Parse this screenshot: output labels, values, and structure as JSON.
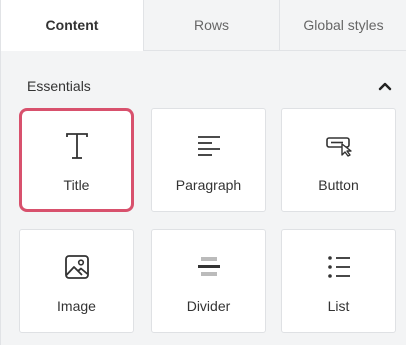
{
  "tabs": [
    {
      "label": "Content",
      "active": true
    },
    {
      "label": "Rows",
      "active": false
    },
    {
      "label": "Global styles",
      "active": false
    }
  ],
  "section": {
    "title": "Essentials",
    "collapse_icon": "chevron-up-icon"
  },
  "blocks": [
    {
      "label": "Title",
      "icon": "title-icon",
      "selected": true
    },
    {
      "label": "Paragraph",
      "icon": "paragraph-icon",
      "selected": false
    },
    {
      "label": "Button",
      "icon": "button-icon",
      "selected": false
    },
    {
      "label": "Image",
      "icon": "image-icon",
      "selected": false
    },
    {
      "label": "Divider",
      "icon": "divider-icon",
      "selected": false
    },
    {
      "label": "List",
      "icon": "list-icon",
      "selected": false
    }
  ],
  "colors": {
    "selected_border": "#d8516d",
    "panel_bg": "#f3f4f5",
    "card_bg": "#ffffff"
  }
}
